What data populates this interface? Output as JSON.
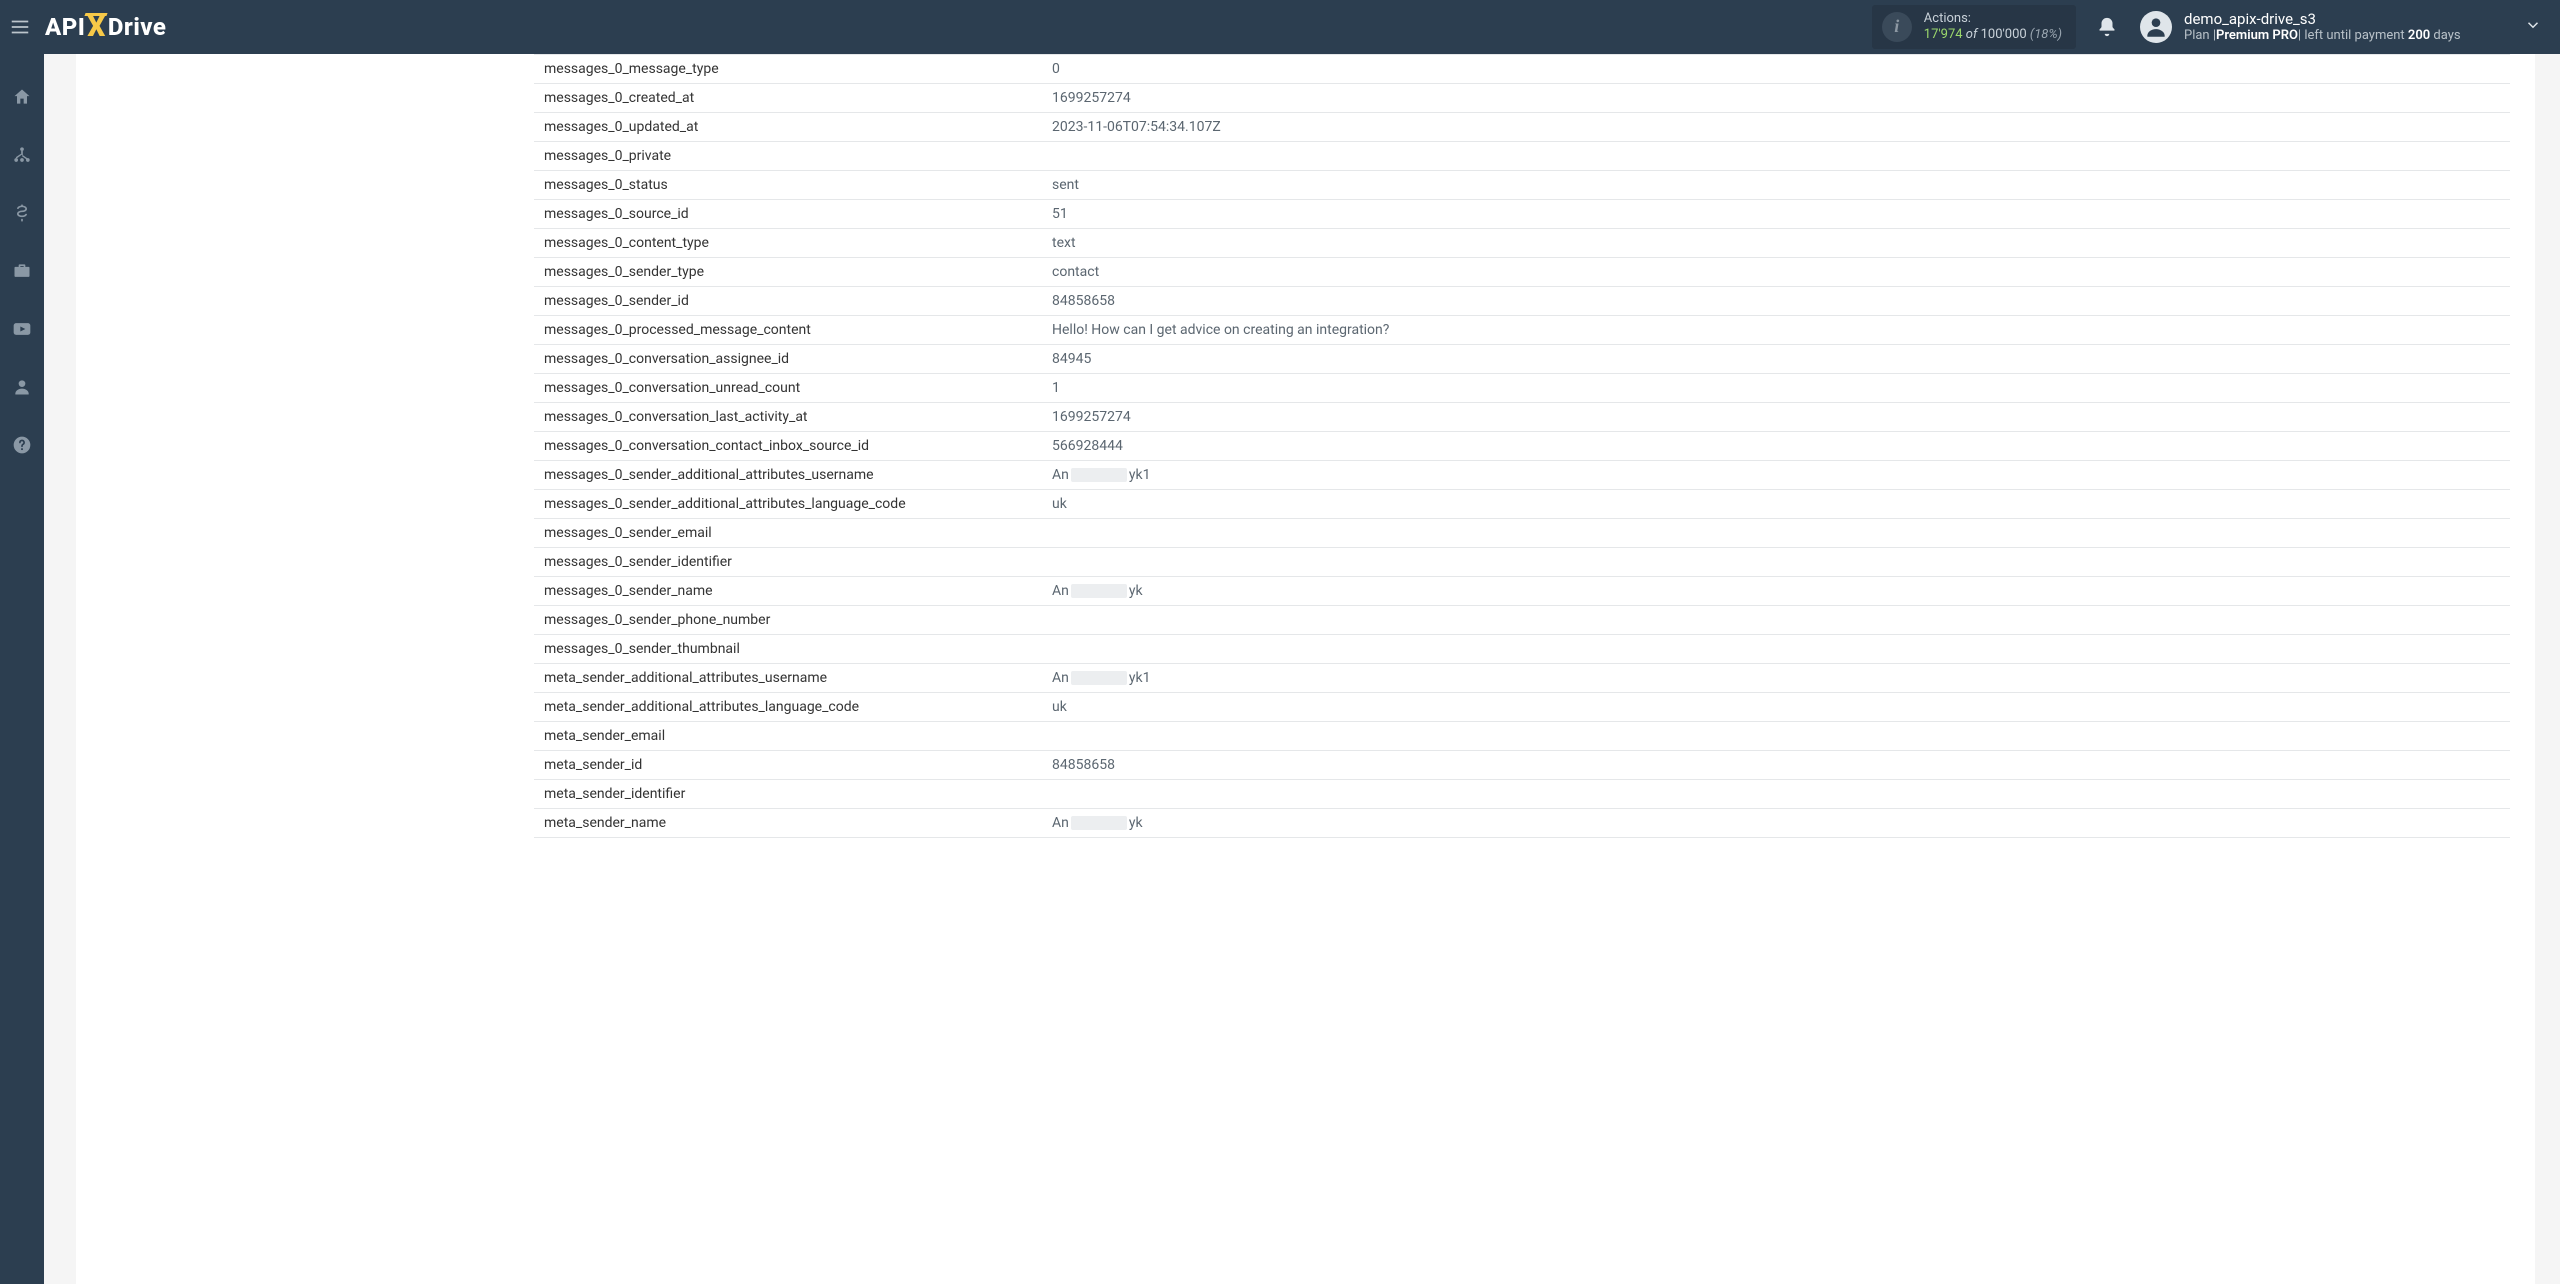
{
  "brand": {
    "part1": "API",
    "part2": "X",
    "part3": "Drive"
  },
  "actions": {
    "title": "Actions:",
    "count_used": "17'974",
    "of_label": " of ",
    "count_total": "100'000",
    "pct": " (18%)"
  },
  "user": {
    "name": "demo_apix-drive_s3",
    "plan_prefix": "Plan |",
    "plan_name": "Premium PRO",
    "plan_mid": "| left until payment ",
    "plan_days": "200",
    "plan_suffix": " days"
  },
  "rows": [
    {
      "key": "messages_0_message_type",
      "val": "0"
    },
    {
      "key": "messages_0_created_at",
      "val": "1699257274"
    },
    {
      "key": "messages_0_updated_at",
      "val": "2023-11-06T07:54:34.107Z"
    },
    {
      "key": "messages_0_private",
      "val": ""
    },
    {
      "key": "messages_0_status",
      "val": "sent"
    },
    {
      "key": "messages_0_source_id",
      "val": "51"
    },
    {
      "key": "messages_0_content_type",
      "val": "text"
    },
    {
      "key": "messages_0_sender_type",
      "val": "contact"
    },
    {
      "key": "messages_0_sender_id",
      "val": "84858658"
    },
    {
      "key": "messages_0_processed_message_content",
      "val": "Hello! How can I get advice on creating an integration?"
    },
    {
      "key": "messages_0_conversation_assignee_id",
      "val": "84945"
    },
    {
      "key": "messages_0_conversation_unread_count",
      "val": "1"
    },
    {
      "key": "messages_0_conversation_last_activity_at",
      "val": "1699257274"
    },
    {
      "key": "messages_0_conversation_contact_inbox_source_id",
      "val": "566928444"
    },
    {
      "key": "messages_0_sender_additional_attributes_username",
      "val": "",
      "redacted": {
        "pre": "An",
        "mid_w": 56,
        "post": "yk1"
      }
    },
    {
      "key": "messages_0_sender_additional_attributes_language_code",
      "val": "uk"
    },
    {
      "key": "messages_0_sender_email",
      "val": ""
    },
    {
      "key": "messages_0_sender_identifier",
      "val": ""
    },
    {
      "key": "messages_0_sender_name",
      "val": "",
      "redacted": {
        "pre": "An",
        "mid_w": 56,
        "post": "yk"
      }
    },
    {
      "key": "messages_0_sender_phone_number",
      "val": ""
    },
    {
      "key": "messages_0_sender_thumbnail",
      "val": ""
    },
    {
      "key": "meta_sender_additional_attributes_username",
      "val": "",
      "redacted": {
        "pre": "An",
        "mid_w": 56,
        "post": "yk1"
      }
    },
    {
      "key": "meta_sender_additional_attributes_language_code",
      "val": "uk"
    },
    {
      "key": "meta_sender_email",
      "val": ""
    },
    {
      "key": "meta_sender_id",
      "val": "84858658"
    },
    {
      "key": "meta_sender_identifier",
      "val": ""
    },
    {
      "key": "meta_sender_name",
      "val": "",
      "redacted": {
        "pre": "An",
        "mid_w": 56,
        "post": "yk"
      }
    }
  ]
}
